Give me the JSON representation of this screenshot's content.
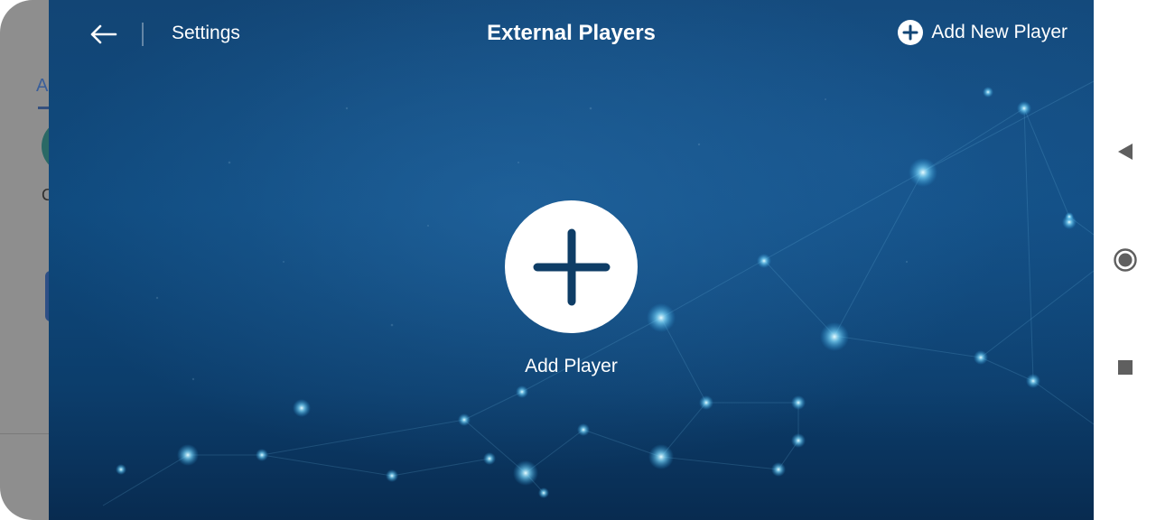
{
  "header": {
    "back_label": "",
    "settings_label": "Settings",
    "title": "External Players",
    "add_new_label": "Add New Player"
  },
  "main": {
    "add_player_label": "Add Player"
  },
  "background_app": {
    "tab_letter": "A",
    "row_letter": "C"
  },
  "icons": {
    "back": "arrow-left-icon",
    "add_new": "plus-circle-icon",
    "add_player": "plus-icon",
    "nav_back": "triangle-back-icon",
    "nav_home": "circle-home-icon",
    "nav_recents": "square-recents-icon"
  },
  "colors": {
    "panel_top": "#124575",
    "panel_bottom": "#082b50",
    "plus_color": "#0e3d66",
    "text": "#ffffff",
    "navbar_bg": "#ffffff",
    "nav_icon": "#5f5f5f"
  }
}
